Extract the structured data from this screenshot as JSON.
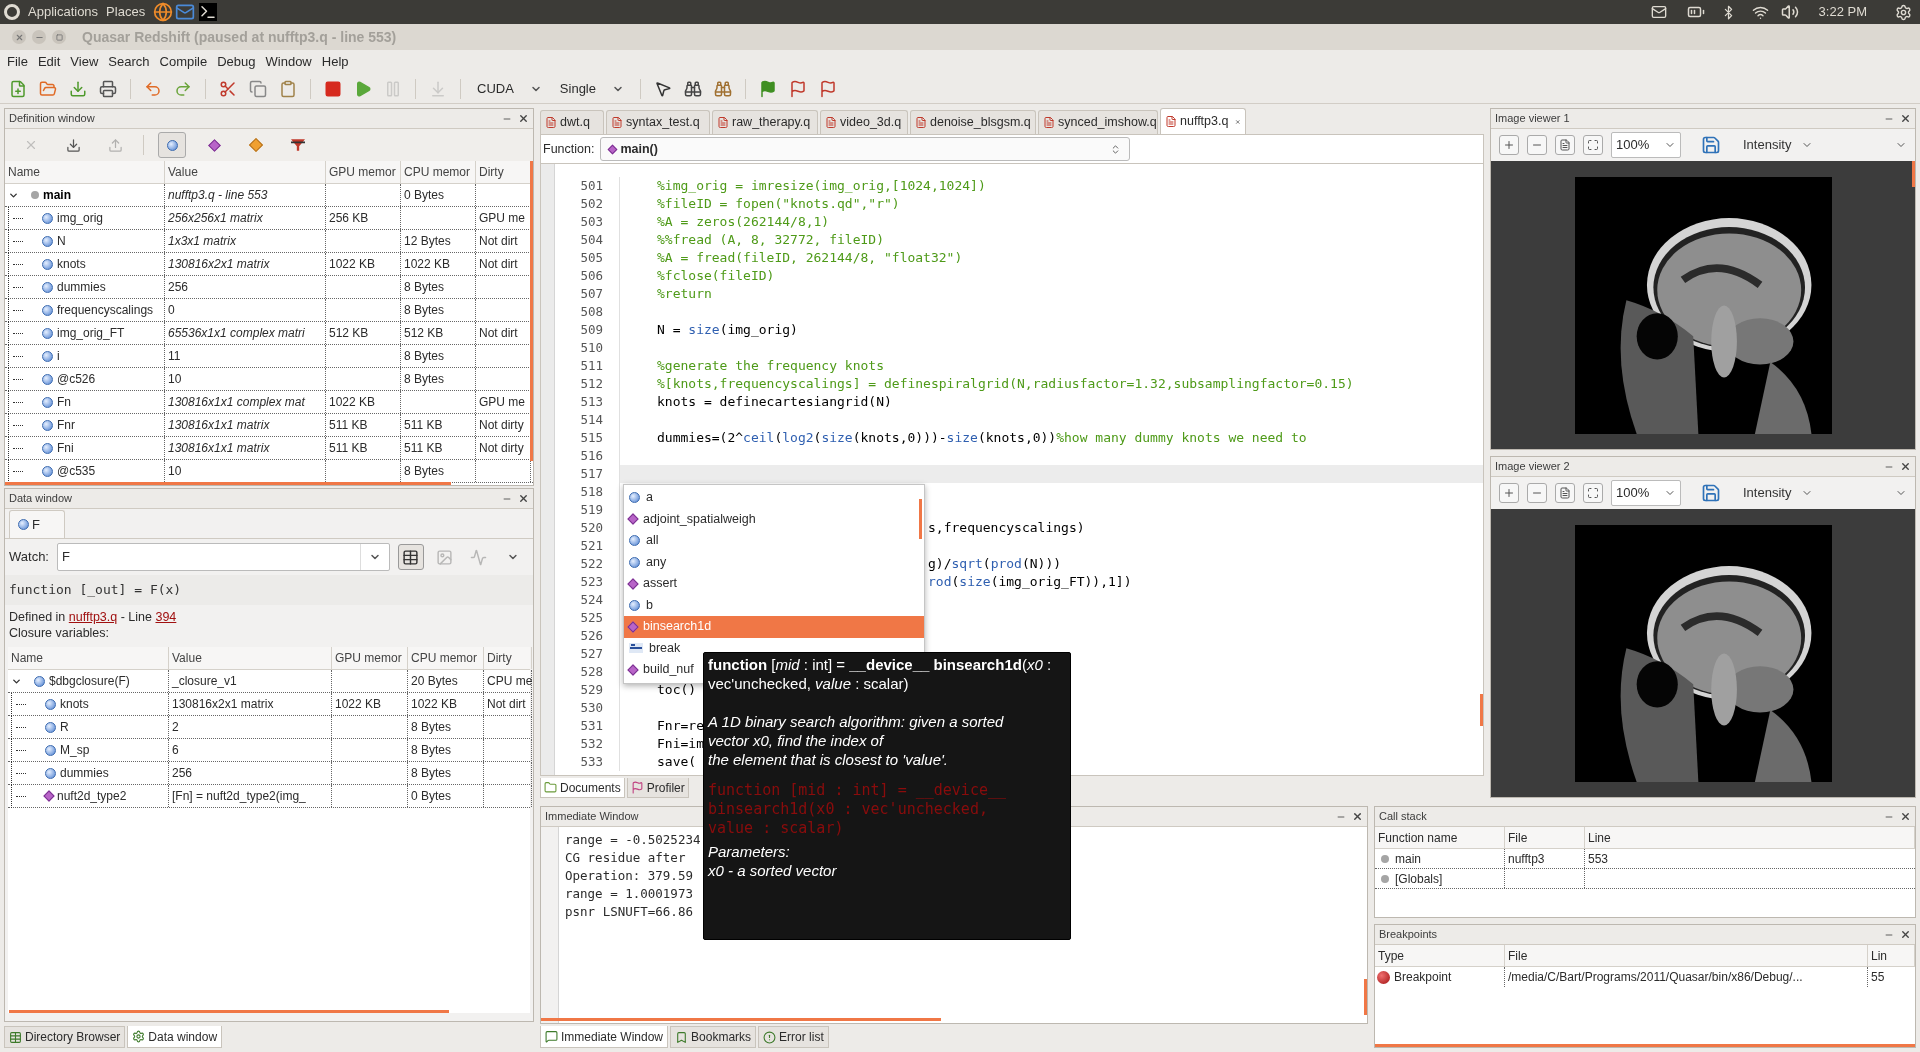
{
  "top_panel": {
    "menus": [
      "Applications",
      "Places"
    ],
    "clock": "3:22 PM"
  },
  "window": {
    "title": "Quasar Redshift (paused at nufftp3.q - line 553)"
  },
  "menu_bar": [
    "File",
    "Edit",
    "View",
    "Search",
    "Compile",
    "Debug",
    "Window",
    "Help"
  ],
  "toolbar": [
    {
      "kind": "button",
      "disabled": false
    },
    {
      "kind": "button",
      "disabled": false
    },
    {
      "kind": "button",
      "disabled": false
    },
    {
      "kind": "button",
      "disabled": false
    },
    {
      "kind": "separator"
    },
    {
      "kind": "button",
      "disabled": false
    },
    {
      "kind": "button",
      "disabled": false
    },
    {
      "kind": "separator"
    },
    {
      "kind": "button",
      "disabled": false
    },
    {
      "kind": "button",
      "disabled": false
    },
    {
      "kind": "button",
      "disabled": false
    },
    {
      "kind": "separator"
    },
    {
      "kind": "button",
      "disabled": false
    },
    {
      "kind": "button",
      "disabled": false
    },
    {
      "kind": "button",
      "disabled": true
    },
    {
      "kind": "separator"
    },
    {
      "kind": "button",
      "disabled": true
    },
    {
      "kind": "separator"
    },
    {
      "kind": "dropdown",
      "label": "CUDA"
    },
    {
      "kind": "dropdown",
      "label": "Single"
    },
    {
      "kind": "separator"
    },
    {
      "kind": "button",
      "disabled": false
    },
    {
      "kind": "button",
      "disabled": false
    },
    {
      "kind": "button",
      "disabled": false
    },
    {
      "kind": "separator"
    },
    {
      "kind": "button",
      "disabled": false
    },
    {
      "kind": "button",
      "disabled": false
    },
    {
      "kind": "button",
      "disabled": false
    }
  ],
  "definition_window": {
    "title": "Definition window",
    "tools": [
      {
        "disabled": true,
        "selected": false
      },
      {
        "disabled": false,
        "selected": false
      },
      {
        "disabled": true,
        "selected": false
      },
      {
        "disabled": false,
        "selected": true
      },
      {
        "disabled": false,
        "selected": false
      },
      {
        "disabled": false,
        "selected": false
      },
      {
        "disabled": false,
        "selected": false
      }
    ],
    "columns": [
      "Name",
      "Value",
      "GPU memor",
      "CPU memor",
      "Dirty"
    ],
    "rows": [
      {
        "name": "main",
        "kind": "scope",
        "expanded": true,
        "value": "nufftp3.q - line 553",
        "italic": true,
        "cpu": "0 Bytes",
        "children": [
          {
            "name": "img_orig",
            "kind": "variable",
            "value": "256x256x1 matrix",
            "italic": true,
            "gpu": "256 KB",
            "dirty": "GPU me"
          },
          {
            "name": "N",
            "kind": "variable",
            "value": "1x3x1 matrix",
            "italic": true,
            "cpu": "12 Bytes",
            "dirty": "Not dirt"
          },
          {
            "name": "knots",
            "kind": "variable",
            "value": "130816x2x1 matrix",
            "italic": true,
            "gpu": "1022 KB",
            "cpu": "1022 KB",
            "dirty": "Not dirt"
          },
          {
            "name": "dummies",
            "kind": "variable",
            "value": "256",
            "italic": false,
            "cpu": "8 Bytes"
          },
          {
            "name": "frequencyscalings",
            "kind": "variable",
            "value": "0",
            "italic": false,
            "cpu": "8 Bytes"
          },
          {
            "name": "img_orig_FT",
            "kind": "variable",
            "value": "65536x1x1 complex matri",
            "italic": true,
            "gpu": "512 KB",
            "cpu": "512 KB",
            "dirty": "Not dirt"
          },
          {
            "name": "i",
            "kind": "variable",
            "value": "11",
            "italic": false,
            "cpu": "8 Bytes"
          },
          {
            "name": "@c526",
            "kind": "variable",
            "value": "10",
            "italic": false,
            "cpu": "8 Bytes"
          },
          {
            "name": "Fn",
            "kind": "variable",
            "value": "130816x1x1 complex mat",
            "italic": true,
            "gpu": "1022 KB",
            "dirty": "GPU me"
          },
          {
            "name": "Fnr",
            "kind": "variable",
            "value": "130816x1x1 matrix",
            "italic": true,
            "gpu": "511 KB",
            "cpu": "511 KB",
            "dirty": "Not dirty"
          },
          {
            "name": "Fni",
            "kind": "variable",
            "value": "130816x1x1 matrix",
            "italic": true,
            "gpu": "511 KB",
            "cpu": "511 KB",
            "dirty": "Not dirty"
          },
          {
            "name": "@c535",
            "kind": "variable",
            "value": "10",
            "italic": false,
            "cpu": "8 Bytes"
          }
        ]
      }
    ]
  },
  "data_window": {
    "title": "Data window",
    "tabs": [
      {
        "label": "F",
        "selected": true
      }
    ],
    "watch": {
      "label": "Watch:",
      "value": "F"
    },
    "views": [
      {
        "selected": true,
        "disabled": false
      },
      {
        "selected": false,
        "disabled": true
      },
      {
        "selected": false,
        "disabled": true
      }
    ],
    "signature": "function [_out] = F(x)",
    "defined": {
      "prefix": "Defined in",
      "file": "nufftp3.q",
      "middle": "- Line",
      "line": "394"
    },
    "closure_label": "Closure variables:",
    "columns": [
      "Name",
      "Value",
      "GPU memor",
      "CPU memor",
      "Dirty"
    ],
    "rows": [
      {
        "name": "$dbgclosure(F)",
        "kind": "variable",
        "expanded": true,
        "value": "_closure_v1",
        "italic": false,
        "cpu": "20 Bytes",
        "dirty": "CPU me",
        "children": [
          {
            "name": "knots",
            "kind": "variable",
            "value": "130816x2x1 matrix",
            "italic": false,
            "gpu": "1022 KB",
            "cpu": "1022 KB",
            "dirty": "Not dirt"
          },
          {
            "name": "R",
            "kind": "variable",
            "value": "2",
            "italic": false,
            "cpu": "8 Bytes"
          },
          {
            "name": "M_sp",
            "kind": "variable",
            "value": "6",
            "italic": false,
            "cpu": "8 Bytes"
          },
          {
            "name": "dummies",
            "kind": "variable",
            "value": "256",
            "italic": false,
            "cpu": "8 Bytes"
          },
          {
            "name": "nuft2d_type2",
            "kind": "function",
            "value": "[Fn] = nuft2d_type2(img_",
            "italic": false,
            "cpu": "0 Bytes"
          }
        ]
      }
    ]
  },
  "left_tabs": [
    {
      "label": "Directory Browser",
      "selected": false
    },
    {
      "label": "Data window",
      "selected": true
    }
  ],
  "editor": {
    "tabs": [
      {
        "label": "dwt.q",
        "selected": false
      },
      {
        "label": "syntax_test.q",
        "selected": false
      },
      {
        "label": "raw_therapy.q",
        "selected": false
      },
      {
        "label": "video_3d.q",
        "selected": false
      },
      {
        "label": "denoise_blsgsm.q",
        "selected": false
      },
      {
        "label": "synced_imshow.q",
        "selected": false
      },
      {
        "label": "nufftp3.q",
        "selected": true
      }
    ],
    "function_label": "Function:",
    "function_value": "main()",
    "lines": [
      {
        "number": "501",
        "kind": "code",
        "current": false,
        "segments": [
          {
            "text": "%img_orig = imresize(img_orig,[1024,1024])",
            "kind": "comment"
          }
        ]
      },
      {
        "number": "502",
        "kind": "code",
        "current": false,
        "segments": [
          {
            "text": "%fileID = fopen(\"knots.qd\",\"r\")",
            "kind": "comment"
          }
        ]
      },
      {
        "number": "503",
        "kind": "code",
        "current": false,
        "segments": [
          {
            "text": "%A = zeros(262144/8,1)",
            "kind": "comment"
          }
        ]
      },
      {
        "number": "504",
        "kind": "code",
        "current": false,
        "segments": [
          {
            "text": "%%fread (A, 8, 32772, fileID)",
            "kind": "comment"
          }
        ]
      },
      {
        "number": "505",
        "kind": "code",
        "current": false,
        "segments": [
          {
            "text": "%A = fread(fileID, 262144/8, \"float32\")",
            "kind": "comment"
          }
        ]
      },
      {
        "number": "506",
        "kind": "code",
        "current": false,
        "segments": [
          {
            "text": "%fclose(fileID)",
            "kind": "comment"
          }
        ]
      },
      {
        "number": "507",
        "kind": "code",
        "current": false,
        "segments": [
          {
            "text": "%return",
            "kind": "comment"
          }
        ]
      },
      {
        "number": "508",
        "kind": "code",
        "current": false
      },
      {
        "number": "509",
        "kind": "code",
        "current": false,
        "segments": [
          {
            "text": "N = ",
            "kind": "plain"
          },
          {
            "text": "size",
            "kind": "function"
          },
          {
            "text": "(img_orig)",
            "kind": "plain"
          }
        ]
      },
      {
        "number": "510",
        "kind": "code",
        "current": false
      },
      {
        "number": "511",
        "kind": "code",
        "current": false,
        "segments": [
          {
            "text": "%generate the frequency knots",
            "kind": "comment"
          }
        ]
      },
      {
        "number": "512",
        "kind": "code",
        "current": false,
        "segments": [
          {
            "text": "%[knots,frequencyscalings] = definespiralgrid(N,radiusfactor=1.32,subsamplingfactor=0.15)",
            "kind": "comment"
          }
        ]
      },
      {
        "number": "513",
        "kind": "code",
        "current": false,
        "segments": [
          {
            "text": "knots = definecartesiangrid(N)",
            "kind": "plain"
          }
        ]
      },
      {
        "number": "514",
        "kind": "code",
        "current": false
      },
      {
        "number": "515",
        "kind": "code",
        "current": false,
        "segments": [
          {
            "text": "dummies=(2^",
            "kind": "plain"
          },
          {
            "text": "ceil",
            "kind": "function"
          },
          {
            "text": "(",
            "kind": "plain"
          },
          {
            "text": "log2",
            "kind": "function"
          },
          {
            "text": "(",
            "kind": "plain"
          },
          {
            "text": "size",
            "kind": "function"
          },
          {
            "text": "(knots,0)))-",
            "kind": "plain"
          },
          {
            "text": "size",
            "kind": "function"
          },
          {
            "text": "(knots,0))",
            "kind": "plain"
          },
          {
            "text": "%how many dummy knots we need to",
            "kind": "comment"
          }
        ]
      },
      {
        "number": "516",
        "kind": "code",
        "current": false
      },
      {
        "number": "517",
        "kind": "code",
        "current": true
      },
      {
        "number": "518",
        "kind": "code",
        "current": false
      },
      {
        "number": "519",
        "kind": "code",
        "current": false
      },
      {
        "number": "520",
        "kind": "tail",
        "current": false,
        "segments": [
          {
            "text": "s,frequencyscalings)",
            "kind": "plain"
          }
        ]
      },
      {
        "number": "521",
        "kind": "code",
        "current": false
      },
      {
        "number": "522",
        "kind": "tail",
        "current": false,
        "segments": [
          {
            "text": "g)/",
            "kind": "plain"
          },
          {
            "text": "sqrt",
            "kind": "function"
          },
          {
            "text": "(",
            "kind": "plain"
          },
          {
            "text": "prod",
            "kind": "function"
          },
          {
            "text": "(N)))",
            "kind": "plain"
          }
        ]
      },
      {
        "number": "523",
        "kind": "tail",
        "current": false,
        "segments": [
          {
            "text": "rod",
            "kind": "function"
          },
          {
            "text": "(",
            "kind": "plain"
          },
          {
            "text": "size",
            "kind": "function"
          },
          {
            "text": "(img_orig_FT)),1])",
            "kind": "plain"
          }
        ]
      },
      {
        "number": "524",
        "kind": "code",
        "current": false
      },
      {
        "number": "525",
        "kind": "code",
        "current": false
      },
      {
        "number": "526",
        "kind": "code",
        "current": false
      },
      {
        "number": "527",
        "kind": "code",
        "current": false
      },
      {
        "number": "528",
        "kind": "code",
        "current": false
      },
      {
        "number": "529",
        "kind": "code",
        "current": false,
        "segments": [
          {
            "text": "toc()",
            "kind": "plain"
          }
        ]
      },
      {
        "number": "530",
        "kind": "code",
        "current": false
      },
      {
        "number": "531",
        "kind": "code",
        "current": false,
        "segments": [
          {
            "text": "Fnr=re",
            "kind": "plain"
          }
        ]
      },
      {
        "number": "532",
        "kind": "code",
        "current": false,
        "segments": [
          {
            "text": "Fni=im",
            "kind": "plain"
          }
        ]
      },
      {
        "number": "533",
        "kind": "code",
        "current": false,
        "segments": [
          {
            "text": "save(",
            "kind": "plain"
          }
        ]
      }
    ],
    "autocomplete": [
      {
        "label": "a",
        "kind": "variable",
        "selected": false
      },
      {
        "label": "adjoint_spatialweigh",
        "kind": "function",
        "selected": false
      },
      {
        "label": "all",
        "kind": "variable",
        "selected": false
      },
      {
        "label": "any",
        "kind": "variable",
        "selected": false
      },
      {
        "label": "assert",
        "kind": "function",
        "selected": false
      },
      {
        "label": "b",
        "kind": "variable",
        "selected": false
      },
      {
        "label": "binsearch1d",
        "kind": "function",
        "selected": true
      },
      {
        "label": "break",
        "kind": "keyword",
        "selected": false
      },
      {
        "label": "build_nuf",
        "kind": "function",
        "selected": false
      }
    ]
  },
  "tooltip": {
    "signature": "**function** [*mid* : int] = **__device__ binsearch1d**(*x0* : vec'unchecked, *value* : scalar)",
    "description": [
      "A 1D binary search algorithm: given a sorted",
      "vector x0, find the index of",
      "the element that is closest to 'value'."
    ],
    "code": [
      "function [mid : int] = __device__",
      "binsearch1d(x0 : vec'unchecked,",
      "value : scalar)"
    ],
    "parameters_label": "Parameters:",
    "parameter": "x0 - a sorted vector"
  },
  "doc_tabs": [
    {
      "label": "Documents",
      "selected": true
    },
    {
      "label": "Profiler",
      "selected": false
    }
  ],
  "immediate_window": {
    "title": "Immediate Window",
    "lines": [
      "range = -0.5025234",
      "CG residue after",
      "Operation: 379.59",
      "range = 1.0001973",
      "psnr LSNUFT=66.86"
    ]
  },
  "bottom_tabs": [
    {
      "label": "Immediate Window",
      "selected": true
    },
    {
      "label": "Bookmarks",
      "selected": false
    },
    {
      "label": "Error list",
      "selected": false
    }
  ],
  "image_viewers": [
    {
      "title": "Image viewer 1",
      "zoom": "100%",
      "channel": "Intensity"
    },
    {
      "title": "Image viewer 2",
      "zoom": "100%",
      "channel": "Intensity"
    }
  ],
  "call_stack": {
    "title": "Call stack",
    "columns": [
      "Function name",
      "File",
      "Line"
    ],
    "rows": [
      {
        "name": "main",
        "file": "nufftp3",
        "line": "553"
      },
      {
        "name": "[Globals]"
      }
    ]
  },
  "breakpoints": {
    "title": "Breakpoints",
    "columns": [
      "Type",
      "File",
      "Lin"
    ],
    "rows": [
      {
        "type": "Breakpoint",
        "file": "/media/C/Bart/Programs/2011/Quasar/bin/x86/Debug/...",
        "line": "55"
      }
    ]
  }
}
